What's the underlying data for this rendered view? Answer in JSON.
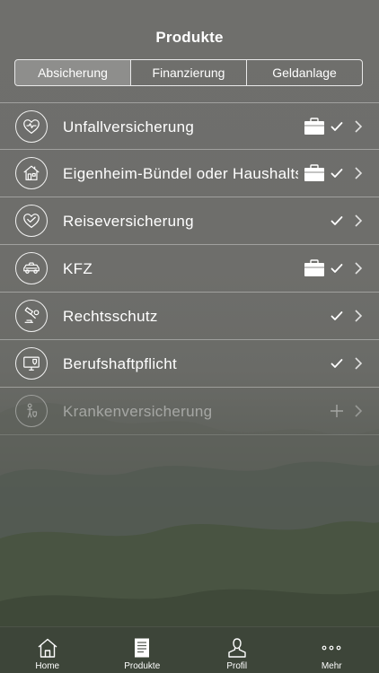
{
  "header": {
    "title": "Produkte"
  },
  "segments": [
    {
      "label": "Absicherung",
      "active": true
    },
    {
      "label": "Finanzierung",
      "active": false
    },
    {
      "label": "Geldanlage",
      "active": false
    }
  ],
  "products": [
    {
      "label": "Unfallversicherung",
      "icon": "heart-shield-icon",
      "has_case": true,
      "status": "check"
    },
    {
      "label": "Eigenheim-Bündel oder Haushalts-",
      "icon": "house-shield-icon",
      "has_case": true,
      "status": "check"
    },
    {
      "label": "Reiseversicherung",
      "icon": "heart-shield-icon",
      "has_case": false,
      "status": "check"
    },
    {
      "label": "KFZ",
      "icon": "car-icon",
      "has_case": true,
      "status": "check"
    },
    {
      "label": "Rechtsschutz",
      "icon": "gavel-icon",
      "has_case": false,
      "status": "check"
    },
    {
      "label": "Berufshaftpflicht",
      "icon": "monitor-shield-icon",
      "has_case": false,
      "status": "check"
    },
    {
      "label": "Krankenversicherung",
      "icon": "person-shield-icon",
      "has_case": false,
      "status": "plus",
      "disabled": true
    }
  ],
  "tabbar": {
    "items": [
      {
        "label": "Home",
        "icon": "home-icon"
      },
      {
        "label": "Produkte",
        "icon": "document-icon",
        "active": true
      },
      {
        "label": "Profil",
        "icon": "person-icon"
      },
      {
        "label": "Mehr",
        "icon": "more-dots-icon"
      }
    ]
  },
  "colors": {
    "text": "#ffffff",
    "background": "#6e6e6b"
  }
}
